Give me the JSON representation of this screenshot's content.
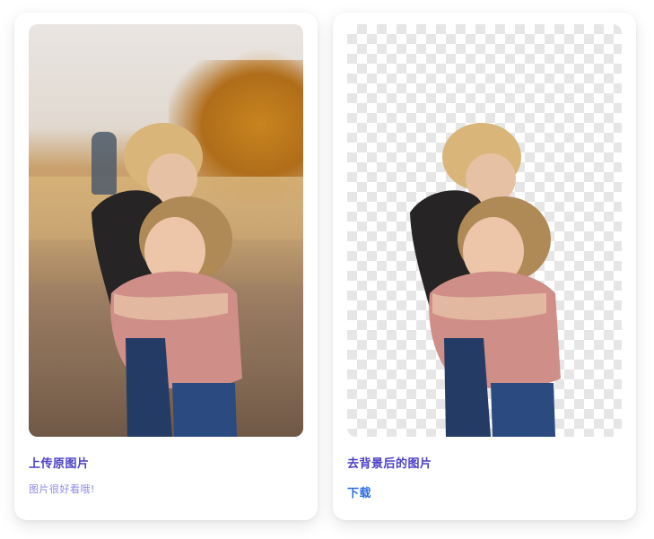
{
  "cards": {
    "original": {
      "title": "上传原图片",
      "subtitle": "图片很好看哦!"
    },
    "result": {
      "title": "去背景后的图片",
      "download_label": "下载"
    }
  },
  "colors": {
    "title": "#4a3fc7",
    "subtitle": "#8f88e6",
    "link": "#2f6fdc"
  }
}
